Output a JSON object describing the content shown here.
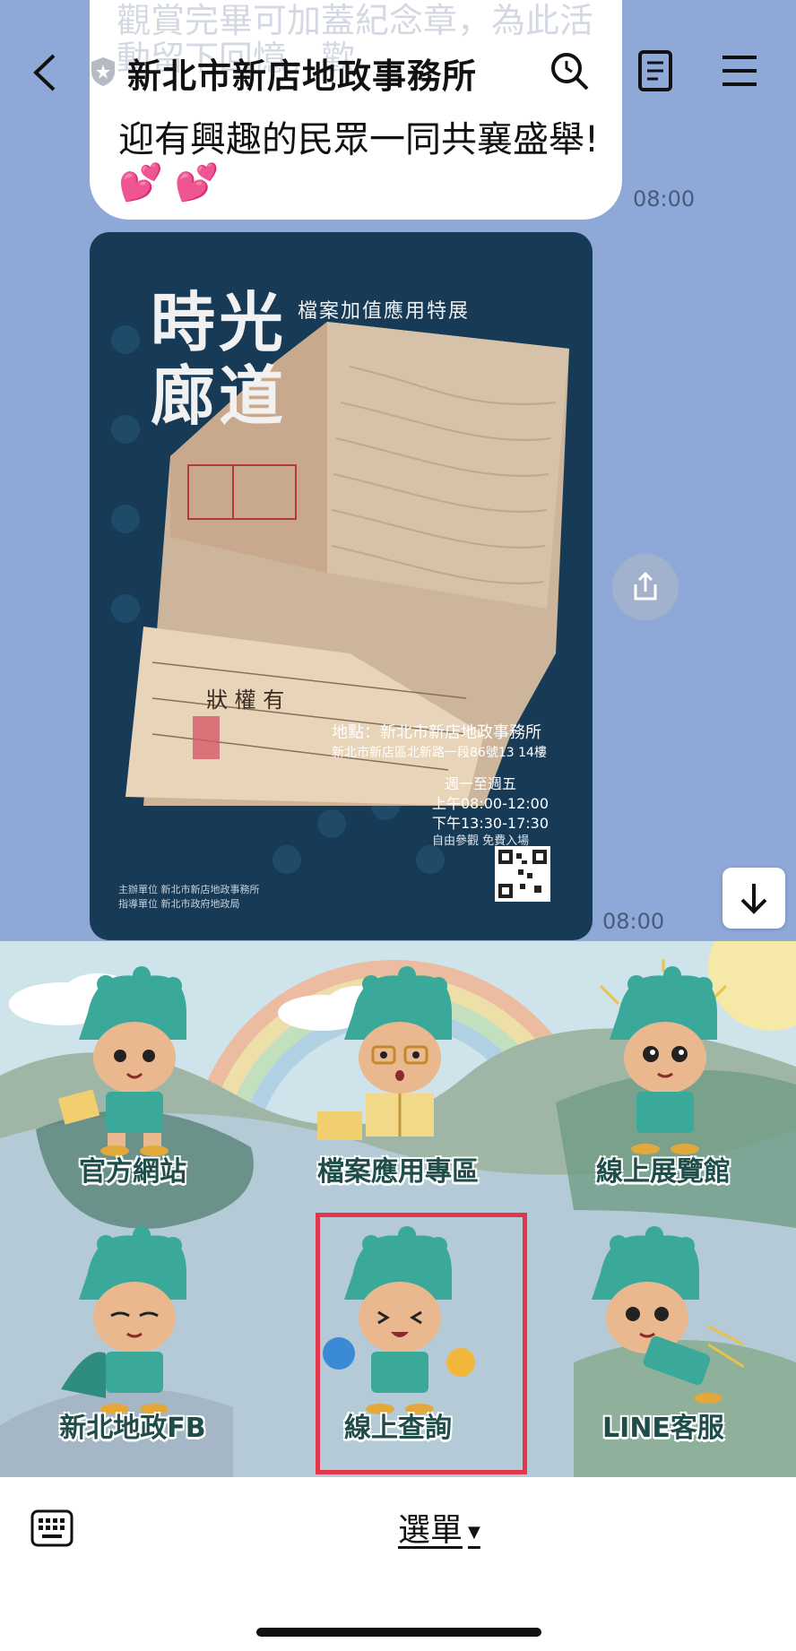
{
  "header": {
    "title": "新北市新店地政事務所"
  },
  "chat": {
    "faded_text": "有展覽紀念戳章，讓參展民眾於觀賞完畢可加蓋紀念章，為此活動留下回憶，歡",
    "message_text": "迎有興趣的民眾一同共襄盛舉!💕 💕",
    "time_1": "08:00",
    "time_2": "08:00"
  },
  "poster": {
    "title_line1": "時光",
    "title_line2": "廊道",
    "subtitle": "檔案加值應用特展",
    "address_line1": "地點：新北市新店地政事務所",
    "address_line2": "新北市新店區北新路一段86號13 14樓",
    "days": "週一至週五",
    "hours_am": "上午08:00-12:00",
    "hours_pm": "下午13:30-17:30",
    "free": "自由參觀  免費入場",
    "organizer": "主辦單位     新北市新店地政事務所",
    "supervisor": "指導單位           新北市政府地政局"
  },
  "rich_menu": {
    "items": [
      {
        "label": "官方網站"
      },
      {
        "label": "檔案應用專區"
      },
      {
        "label": "線上展覽館"
      },
      {
        "label": "新北地政FB"
      },
      {
        "label": "線上查詢"
      },
      {
        "label": "LINE客服"
      }
    ]
  },
  "bottom_bar": {
    "menu_label": "選單",
    "caret": "▼"
  },
  "colors": {
    "chat_bg": "#8ea8d8",
    "poster_bg": "#173a56",
    "menu_label": "#1e4d4a",
    "mascot_green": "#3aa99a",
    "highlight": "#e3364a"
  }
}
